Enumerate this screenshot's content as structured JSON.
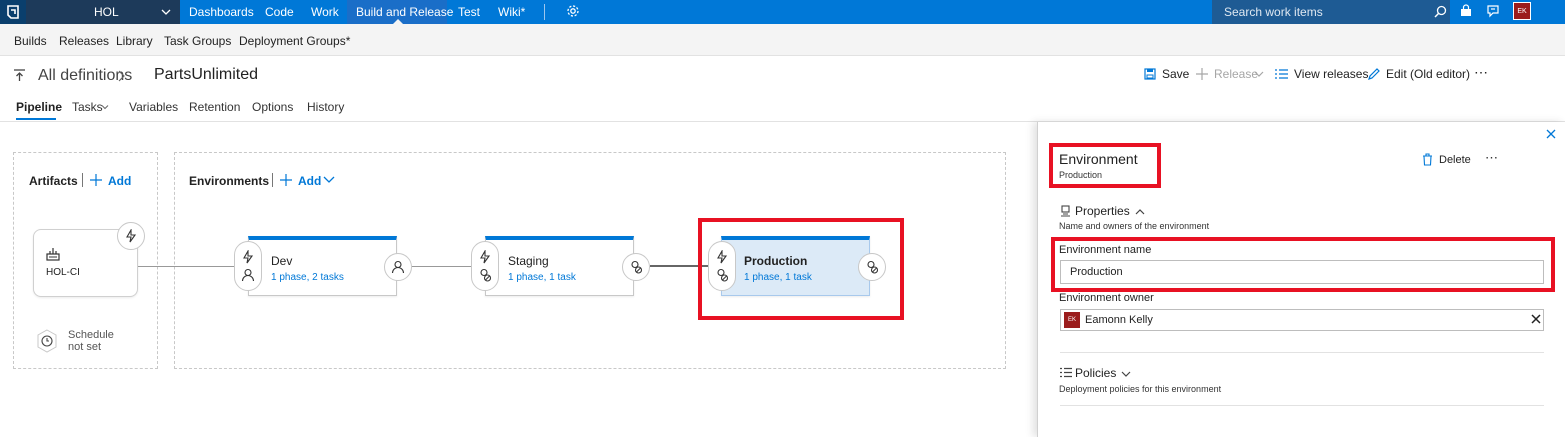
{
  "topbar": {
    "project": "HOL",
    "nav": [
      "Dashboards",
      "Code",
      "Work",
      "Build and Release",
      "Test",
      "Wiki*"
    ],
    "active_nav": "Build and Release",
    "search_placeholder": "Search work items",
    "user_initials": "EK"
  },
  "subnav": [
    "Builds",
    "Releases",
    "Library",
    "Task Groups",
    "Deployment Groups*"
  ],
  "header": {
    "breadcrumb": "All definitions",
    "title": "PartsUnlimited",
    "commands": {
      "save": "Save",
      "release": "Release",
      "view_releases": "View releases",
      "edit_old": "Edit (Old editor)",
      "more": "⋯"
    }
  },
  "tabs": [
    "Pipeline",
    "Tasks",
    "Variables",
    "Retention",
    "Options",
    "History"
  ],
  "active_tab": "Pipeline",
  "pipeline": {
    "artifacts": {
      "title": "Artifacts",
      "add": "Add",
      "items": [
        {
          "name": "HOL-CI"
        }
      ],
      "schedule": [
        "Schedule",
        "not set"
      ]
    },
    "environments": {
      "title": "Environments",
      "add": "Add",
      "items": [
        {
          "name": "Dev",
          "summary": "1 phase, 2 tasks"
        },
        {
          "name": "Staging",
          "summary": "1 phase, 1 task"
        },
        {
          "name": "Production",
          "summary": "1 phase, 1 task",
          "selected": true
        }
      ]
    }
  },
  "panel": {
    "title": "Environment",
    "subtitle": "Production",
    "delete": "Delete",
    "more": "⋯",
    "properties": {
      "title": "Properties",
      "description": "Name and owners of the environment",
      "name_label": "Environment name",
      "name_value": "Production",
      "owner_label": "Environment owner",
      "owner_name": "Eamonn Kelly",
      "owner_initials": "EK"
    },
    "policies": {
      "title": "Policies",
      "description": "Deployment policies for this environment"
    }
  },
  "colors": {
    "accent": "#0078d7",
    "topbar": "#0078d7",
    "highlight": "#e81123",
    "selected_card": "#dceaf7"
  }
}
